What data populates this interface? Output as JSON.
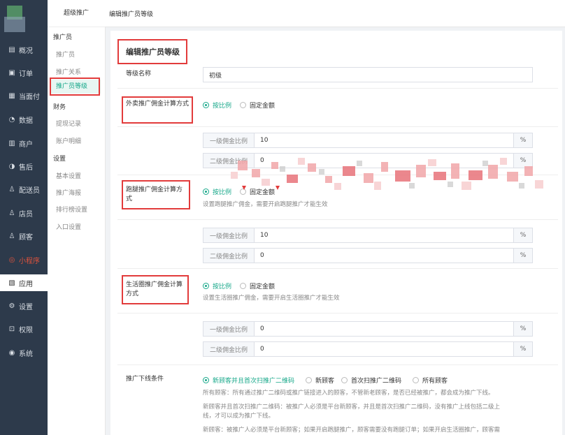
{
  "sidebar": {
    "items": [
      {
        "label": "概况",
        "icon": "overview-icon",
        "glyph": "▤"
      },
      {
        "label": "订单",
        "icon": "order-icon",
        "glyph": "▣"
      },
      {
        "label": "当面付",
        "icon": "pay-icon",
        "glyph": "▦"
      },
      {
        "label": "数据",
        "icon": "data-icon",
        "glyph": "◔"
      },
      {
        "label": "商户",
        "icon": "merchant-icon",
        "glyph": "▥"
      },
      {
        "label": "售后",
        "icon": "aftersale-icon",
        "glyph": "◑"
      },
      {
        "label": "配送员",
        "icon": "courier-icon",
        "glyph": "♙"
      },
      {
        "label": "店员",
        "icon": "clerk-icon",
        "glyph": "♙"
      },
      {
        "label": "顾客",
        "icon": "customer-icon",
        "glyph": "♙"
      },
      {
        "label": "小程序",
        "icon": "miniprogram-icon",
        "glyph": "◎"
      },
      {
        "label": "应用",
        "icon": "apps-icon",
        "glyph": "▧"
      },
      {
        "label": "设置",
        "icon": "settings-icon",
        "glyph": "⚙"
      },
      {
        "label": "权限",
        "icon": "lock-icon",
        "glyph": "⊡"
      },
      {
        "label": "系统",
        "icon": "system-icon",
        "glyph": "◉"
      }
    ],
    "accent_red": "#e0533c"
  },
  "submenu": {
    "title": "超级推广",
    "groups": [
      {
        "label": "推广员",
        "items": [
          "推广员",
          "推广关系",
          "推广员等级"
        ]
      },
      {
        "label": "财务",
        "items": [
          "提现记录",
          "账户明细"
        ]
      },
      {
        "label": "设置",
        "items": [
          "基本设置",
          "推广海报",
          "排行榜设置",
          "入口设置"
        ]
      }
    ],
    "selected": "推广员等级"
  },
  "header": {
    "title": "编辑推广员等级"
  },
  "form": {
    "heading": "编辑推广员等级",
    "level_name_label": "等级名称",
    "level_name_value": "初级",
    "takeout": {
      "label": "外卖推广佣金计算方式",
      "opt_ratio": "按比例",
      "opt_fixed": "固定金额",
      "level1_label": "一级佣金比例",
      "level1_value": "10",
      "level2_label": "二级佣金比例",
      "level2_value": "0",
      "unit": "%"
    },
    "errand": {
      "label": "跑腿推广佣金计算方式",
      "opt_ratio": "按比例",
      "opt_fixed": "固定金额",
      "tip": "设置跑腿推广佣金，需要开启跑腿推广才能生效",
      "level1_label": "一级佣金比例",
      "level1_value": "10",
      "level2_label": "二级佣金比例",
      "level2_value": "0",
      "unit": "%"
    },
    "life": {
      "label": "生活圈推广佣金计算方式",
      "opt_ratio": "按比例",
      "opt_fixed": "固定金额",
      "tip": "设置生活圈推广佣金，需要开启生活圈推广才能生效",
      "level1_label": "一级佣金比例",
      "level1_value": "0",
      "level2_label": "二级佣金比例",
      "level2_value": "0",
      "unit": "%"
    },
    "condition": {
      "label": "推广下线条件",
      "options": [
        "新顾客并且首次扫推广二维码",
        "新顾客",
        "首次扫推广二维码",
        "所有顾客"
      ],
      "desc1": "所有顾客：所有通过推广二维码或推广链接进入的顾客，不管新老顾客，是否已经被推广，都会成为推广下线。",
      "desc2a": "新顾客并且首次扫推广二维码：被推广人必须是平台新顾客，并且是首次扫推广二维码，没有推广上线包括二级上",
      "desc2b": "线，才可以成为推广下线。",
      "desc3": "新顾客：被推广人必须是平台新顾客；如果开启跑腿推广，顾客需要没有跑腿订单；如果开启生活圈推广，顾客需"
    }
  },
  "colors": {
    "sidebar_bg": "#2d3a4b",
    "accent": "#17a88a",
    "highlight_box": "#e23b3b"
  }
}
